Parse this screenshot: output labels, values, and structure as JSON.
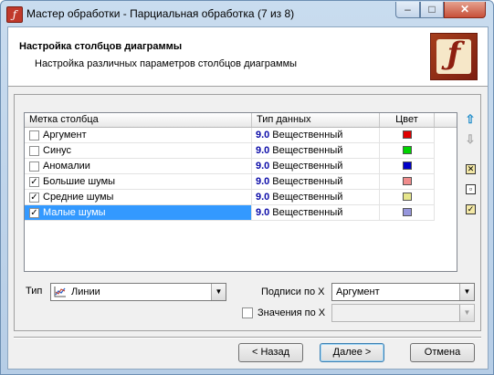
{
  "window": {
    "title": "Мастер обработки - Парциальная обработка  (7 из 8)",
    "icon": "deductor-logo-icon",
    "controls": {
      "minimize": "–",
      "maximize": "□",
      "close": "✕"
    }
  },
  "header": {
    "title": "Настройка столбцов диаграммы",
    "subtitle": "Настройка различных параметров столбцов диаграммы",
    "logo": "ƒ"
  },
  "grid": {
    "columns": [
      "Метка столбца",
      "Тип данных",
      "Цвет"
    ],
    "rows": [
      {
        "checked": false,
        "label": "Аргумент",
        "type_prefix": "9.0",
        "type": "Вещественный",
        "color": "#e00000",
        "selected": false
      },
      {
        "checked": false,
        "label": "Синус",
        "type_prefix": "9.0",
        "type": "Вещественный",
        "color": "#00d400",
        "selected": false
      },
      {
        "checked": false,
        "label": "Аномалии",
        "type_prefix": "9.0",
        "type": "Вещественный",
        "color": "#0000c8",
        "selected": false
      },
      {
        "checked": true,
        "label": "Большие шумы",
        "type_prefix": "9.0",
        "type": "Вещественный",
        "color": "#f08c8c",
        "selected": false
      },
      {
        "checked": true,
        "label": "Средние шумы",
        "type_prefix": "9.0",
        "type": "Вещественный",
        "color": "#e6e68c",
        "selected": false
      },
      {
        "checked": true,
        "label": "Малые шумы",
        "type_prefix": "9.0",
        "type": "Вещественный",
        "color": "#9696dc",
        "selected": true
      }
    ],
    "check_mark": "✓"
  },
  "side_buttons": {
    "up": "⇧",
    "down": "⇩",
    "b1": "✕",
    "b2": "▫",
    "b3": "✓"
  },
  "options": {
    "type_label": "Тип",
    "type_value": "Линии",
    "x_labels_label": "Подписи по X",
    "x_labels_value": "Аргумент",
    "x_values_label": "Значения по X",
    "x_values_checked": false,
    "x_values_value": ""
  },
  "footer": {
    "back": "< Назад",
    "next": "Далее >",
    "cancel": "Отмена"
  }
}
